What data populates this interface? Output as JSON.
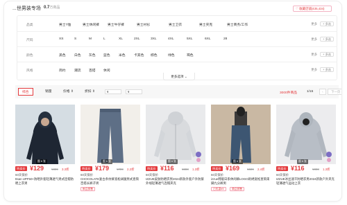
{
  "header": {
    "title": "...世男装专场",
    "count": "0.7",
    "count_unit": "万商品",
    "favorite_label": "收藏店铺(435,434)"
  },
  "filters": [
    {
      "label": "品类",
      "options": [
        "男士T恤",
        "男士休闲裤",
        "男士牛仔裤",
        "男士衬衫",
        "男士卫衣",
        "男士夹克",
        "男士商务/工作"
      ],
      "more": "更多",
      "multi": "+ 多选"
    },
    {
      "label": "尺码",
      "options": [
        "XS",
        "S",
        "M",
        "L",
        "XL",
        "2XL",
        "3XL",
        "4XL",
        "5XL",
        "6XL",
        "28"
      ],
      "more": "更多",
      "multi": "+ 多选"
    },
    {
      "label": "颜色",
      "options": [
        "黑色",
        "白色",
        "灰色",
        "蓝色",
        "米色",
        "卡其色",
        "棕色",
        "绿色",
        "褐色"
      ],
      "more": "更多",
      "multi": "+ 多选"
    },
    {
      "label": "风格",
      "options": [
        "简约",
        "潮流",
        "百搭",
        "休闲"
      ],
      "more": "更多",
      "multi": "+ 多选"
    }
  ],
  "more_options": "更多选项 ⌄",
  "sort": {
    "items": [
      "综合",
      "销量",
      "价格 ⇕",
      "折扣 ⇕"
    ],
    "price_min_placeholder": "¥",
    "price_max_placeholder": "¥",
    "total": "3000件商品",
    "page": "1/15",
    "prev": "‹",
    "next": "下一页 ›"
  },
  "products": [
    {
      "badge": "特卖价",
      "price": "¥129",
      "orig": "¥399",
      "disc": "3.3折",
      "ship": "60天保价",
      "name": "ttsan UPF50+防晒外套轻薄透气男式连帽防晒上衣男",
      "tags": [],
      "img_count": "",
      "bg": "#d5dde3"
    },
    {
      "badge": "特卖价",
      "price": "¥179",
      "orig": "¥799",
      "disc": "2.2折",
      "ship": "60天保价",
      "name": "CHOCOLATE复古条纹裤宽松阔腿男式直筒百搭长裤子男",
      "tags": [
        "新品预售"
      ],
      "img_count": "",
      "bg": "#f2efea"
    },
    {
      "badge": "特卖价",
      "price": "¥116",
      "orig": "¥898",
      "disc": "1.3折",
      "ship": "60天保价",
      "name": "IZZUE皮肤防晒衣男2024新款外套户外防紫外线轻薄透气连帽夹克",
      "tags": [],
      "img_count": "",
      "bg": "#e9eaec"
    },
    {
      "badge": "特卖价",
      "price": "¥169",
      "orig": "¥699",
      "disc": "2.4折",
      "ship": "60天保价",
      "name": "izzue韩版日系休闲裤LOGO刺绣宽松直筒束脚九分裤男",
      "tags": [
        "已优惠¥9",
        "商品预售"
      ],
      "img_count": "",
      "bg": "#c9b8a3"
    },
    {
      "badge": "特卖价",
      "price": "¥116",
      "orig": "¥898",
      "disc": "1.3折",
      "ship": "60天保价",
      "name": "IZZUE冰丝速干防晒衣男2024新款户外夹克轻薄透气运动上衣",
      "tags": [],
      "img_count": "",
      "bg": "#ececee"
    }
  ],
  "img_count_labels": [
    "图 6 张",
    "图 6 张",
    "图 6 张",
    "图 6 张",
    "图 6 张"
  ],
  "colors": {
    "accent": "#e4393c",
    "border": "#eeeeee"
  }
}
